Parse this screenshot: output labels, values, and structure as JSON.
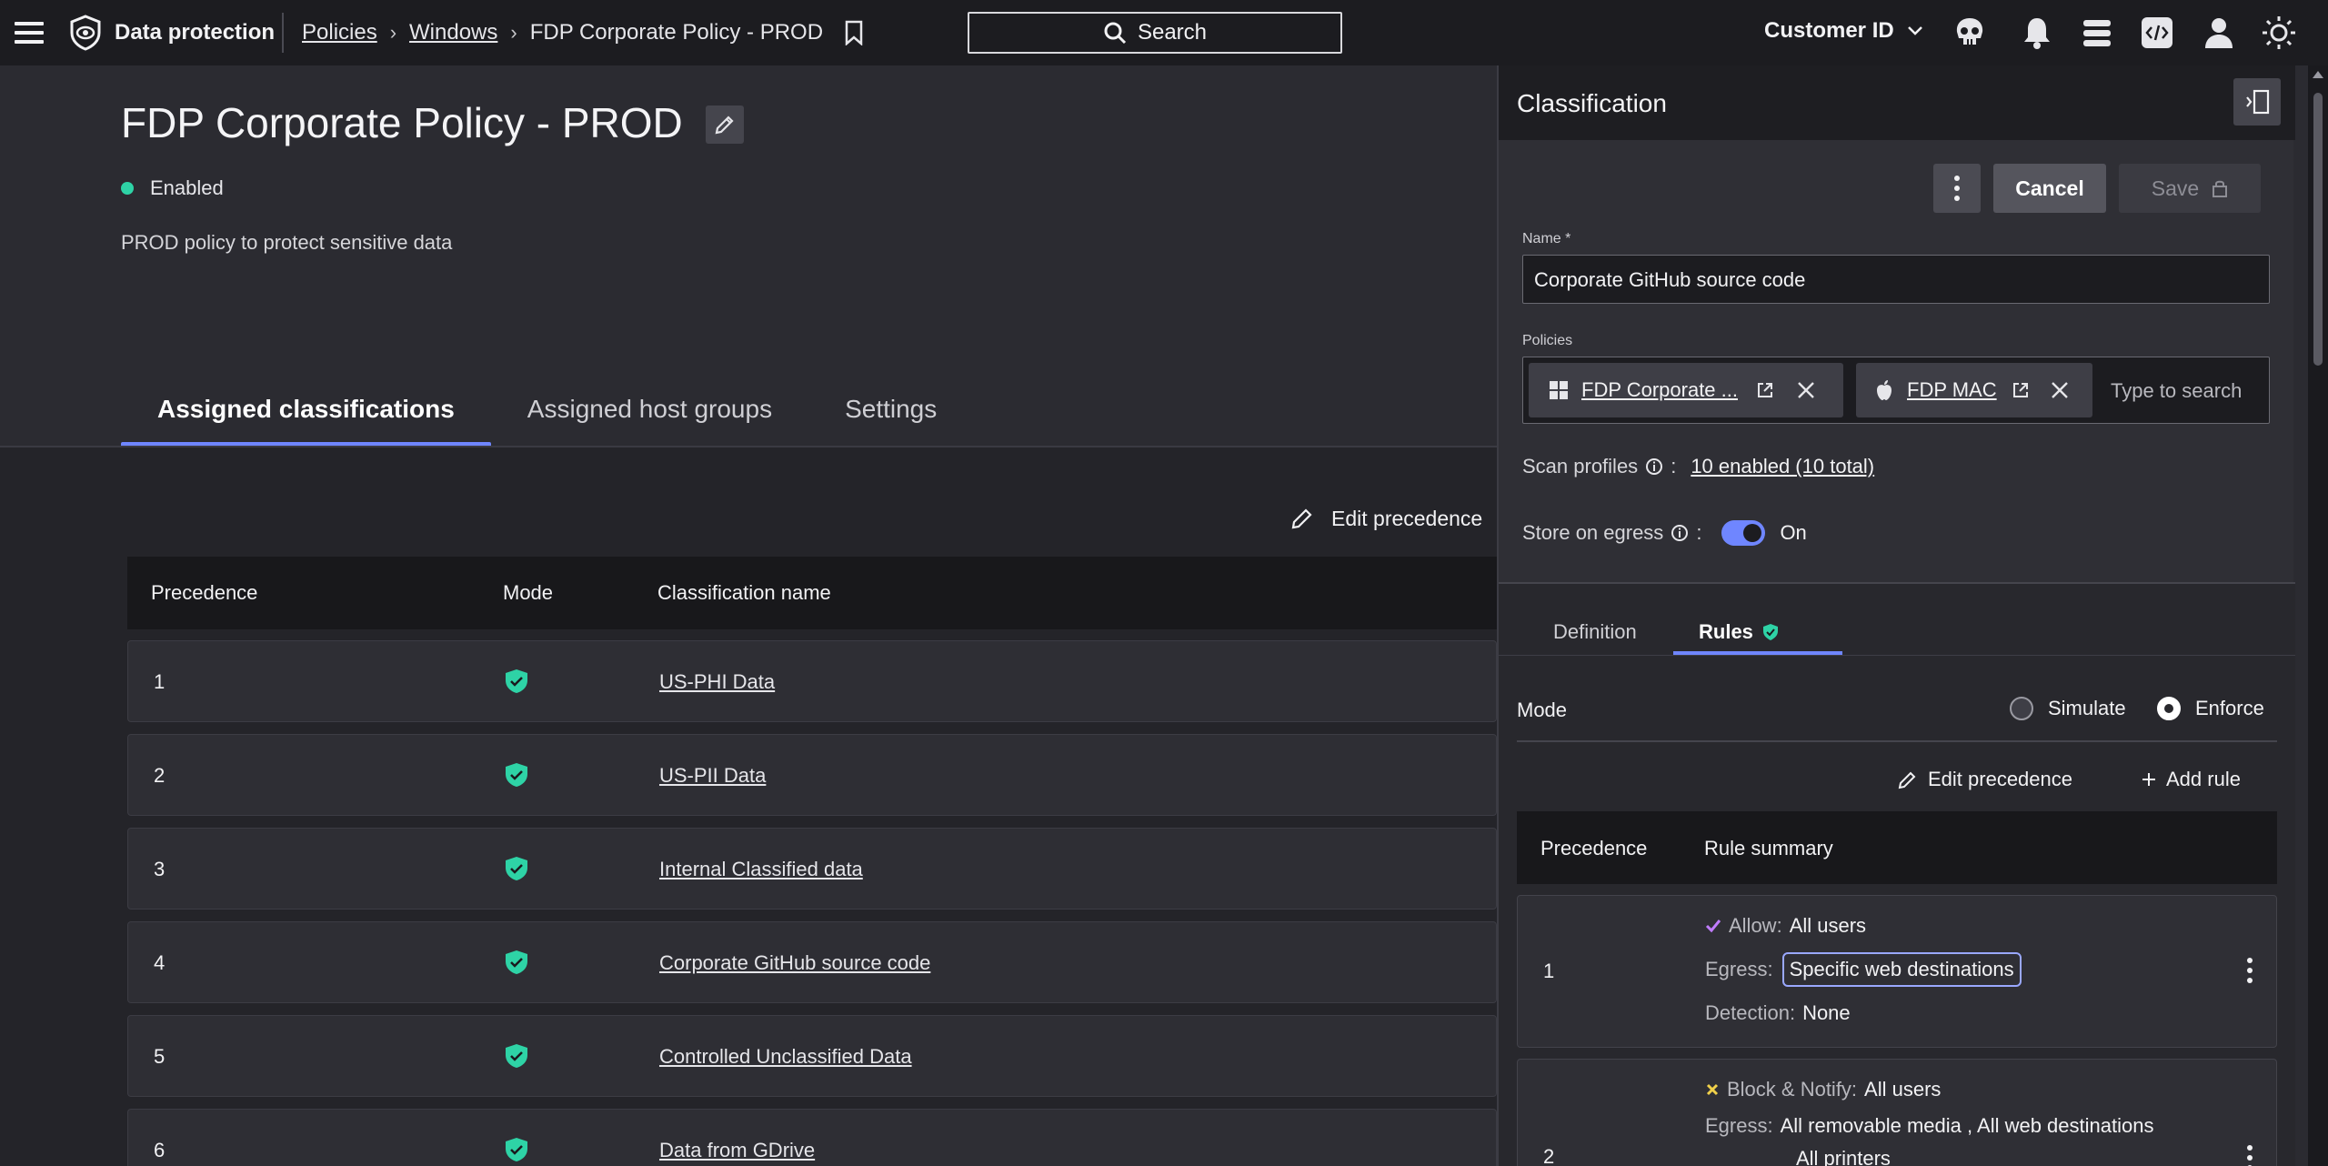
{
  "topbar": {
    "app_name": "Data protection",
    "breadcrumb": [
      "Policies",
      "Windows",
      "FDP Corporate Policy - PROD"
    ],
    "search_label": "Search",
    "customer_label": "Customer ID",
    "icons": [
      "menu-icon",
      "shield-eye-logo-icon",
      "bookmark-icon",
      "search-icon",
      "chevron-down-icon",
      "skull-icon",
      "bell-icon",
      "stack-icon",
      "code-icon",
      "user-icon",
      "sun-icon"
    ]
  },
  "policy": {
    "title": "FDP Corporate Policy - PROD",
    "status": "Enabled",
    "description": "PROD policy to protect sensitive data"
  },
  "tabs": [
    "Assigned classifications",
    "Assigned host groups",
    "Settings"
  ],
  "table": {
    "edit_precedence": "Edit precedence",
    "headers": {
      "precedence": "Precedence",
      "mode": "Mode",
      "name": "Classification name"
    },
    "rows": [
      {
        "precedence": "1",
        "name": "US-PHI Data"
      },
      {
        "precedence": "2",
        "name": "US-PII Data"
      },
      {
        "precedence": "3",
        "name": "Internal Classified data"
      },
      {
        "precedence": "4",
        "name": "Corporate GitHub source code"
      },
      {
        "precedence": "5",
        "name": "Controlled Unclassified Data"
      },
      {
        "precedence": "6",
        "name": "Data from GDrive"
      }
    ]
  },
  "panel": {
    "title": "Classification",
    "cancel": "Cancel",
    "save": "Save",
    "name_label": "Name *",
    "name_value": "Corporate GitHub source code",
    "policies_label": "Policies",
    "policy_chips": [
      "FDP Corporate ...",
      "FDP MAC"
    ],
    "policies_placeholder": "Type to search",
    "scan_profiles_label": "Scan profiles",
    "scan_profiles_value": "10 enabled (10 total)",
    "store_egress_label": "Store on egress",
    "store_egress_state": "On",
    "tabs": [
      "Definition",
      "Rules"
    ],
    "mode_label": "Mode",
    "mode_options": [
      "Simulate",
      "Enforce"
    ],
    "edit_precedence": "Edit precedence",
    "add_rule": "Add rule",
    "rules_headers": {
      "precedence": "Precedence",
      "summary": "Rule summary"
    },
    "rules": [
      {
        "precedence": "1",
        "action_label": "Allow:",
        "action_value": "All users",
        "egress_label": "Egress:",
        "egress_value": "Specific web destinations",
        "detection_label": "Detection:",
        "detection_value": "None"
      },
      {
        "precedence": "2",
        "action_label": "Block & Notify:",
        "action_value": "All users",
        "egress_label": "Egress:",
        "egress_value": "All removable media , All web destinations",
        "egress_value_2": "All printers"
      }
    ]
  },
  "colors": {
    "accent": "#6f86ff",
    "enabled_green": "#2ed3a6",
    "allow_check": "#c07cff",
    "block_x": "#f0d04a"
  }
}
